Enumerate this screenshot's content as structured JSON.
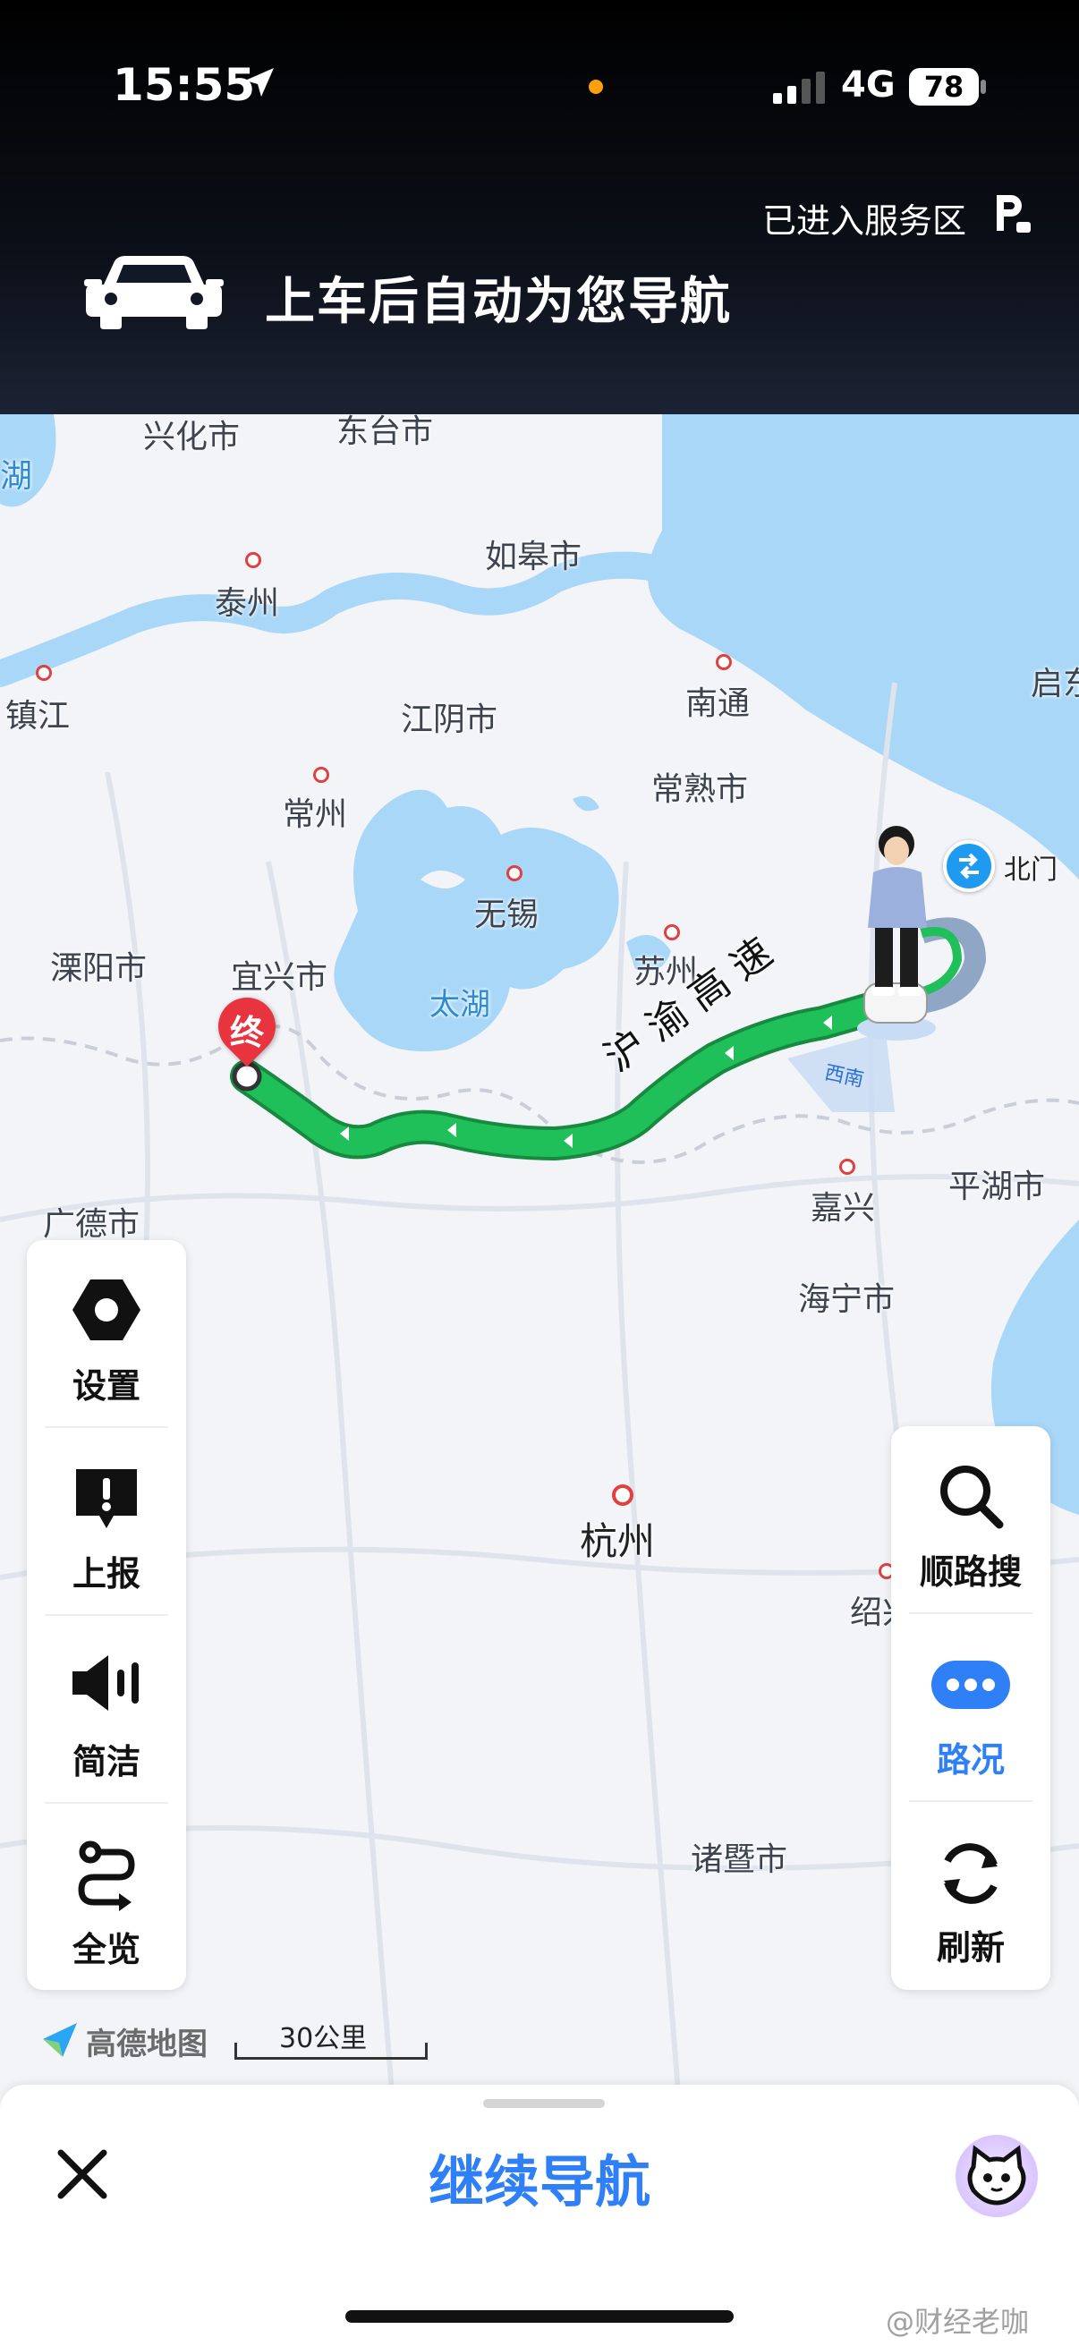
{
  "status_bar": {
    "time": "15:55",
    "network": "4G",
    "battery": "78"
  },
  "header": {
    "service_area": "已进入服务区",
    "banner": "上车后自动为您导航"
  },
  "map": {
    "cities": {
      "xinghua": "兴化市",
      "dongtai": "东台市",
      "rugao": "如皋市",
      "taizhou": "泰州",
      "zhenjiang": "镇江",
      "jiangyin": "江阴市",
      "nantong": "南通",
      "qidong": "启东",
      "changshu": "常熟市",
      "changzhou": "常州",
      "wuxi": "无锡",
      "liyang": "溧阳市",
      "yixing": "宜兴市",
      "suzhou": "苏州",
      "taihu": "太湖",
      "guangde": "广德市",
      "jiaxing": "嘉兴",
      "pinghu": "平湖市",
      "haining": "海宁市",
      "hangzhou": "杭州",
      "shaoxing": "绍兴",
      "zhuji": "诸暨市",
      "hu": "湖"
    },
    "road_name": "沪渝高速",
    "destination_marker": "终",
    "poi_label": "北门",
    "heading_label": "西南",
    "logo_text": "高德地图",
    "scale_text": "30公里"
  },
  "left_panel": [
    {
      "label": "设置",
      "icon": "settings-icon"
    },
    {
      "label": "上报",
      "icon": "report-icon"
    },
    {
      "label": "简洁",
      "icon": "speaker-icon"
    },
    {
      "label": "全览",
      "icon": "overview-route-icon"
    }
  ],
  "right_panel": [
    {
      "label": "顺路搜",
      "icon": "search-icon"
    },
    {
      "label": "路况",
      "icon": "traffic-icon"
    },
    {
      "label": "刷新",
      "icon": "refresh-icon"
    }
  ],
  "bottom": {
    "continue_label": "继续导航"
  },
  "watermark": "@财经老咖",
  "colors": {
    "accent": "#2f7ff6",
    "route": "#1fbf5a",
    "water": "#a9d7f7"
  }
}
